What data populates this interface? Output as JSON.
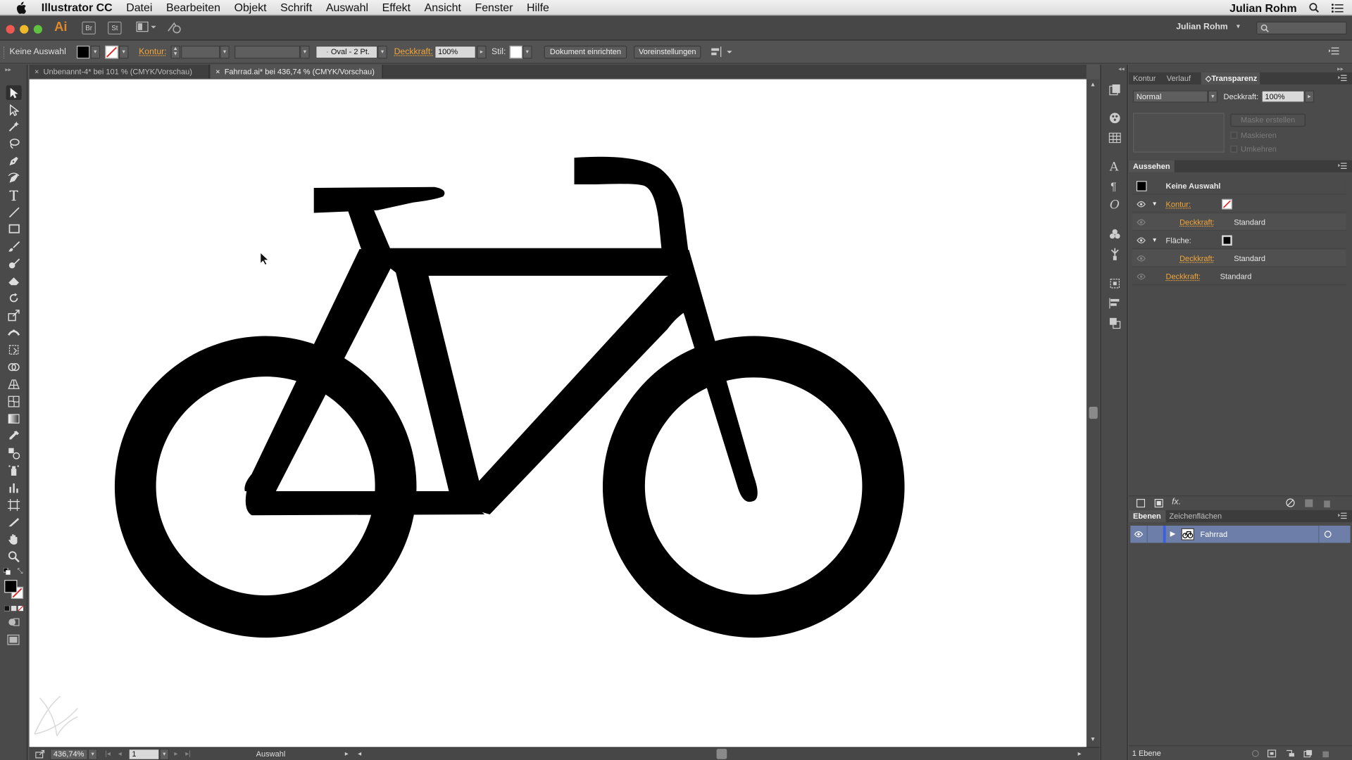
{
  "menubar": {
    "app_name": "Illustrator CC",
    "items": [
      "Datei",
      "Bearbeiten",
      "Objekt",
      "Schrift",
      "Auswahl",
      "Effekt",
      "Ansicht",
      "Fenster",
      "Hilfe"
    ],
    "user": "Julian Rohm"
  },
  "appbar": {
    "logo": "Ai",
    "bridge": "Br",
    "stock": "St",
    "user": "Julian Rohm",
    "search_placeholder": ""
  },
  "controlbar": {
    "selection": "Keine Auswahl",
    "kontur_label": "Kontur:",
    "brush_value": "Oval - 2 Pt.",
    "opacity_label": "Deckkraft:",
    "opacity_value": "100%",
    "style_label": "Stil:",
    "doc_setup_button": "Dokument einrichten",
    "prefs_button": "Voreinstellungen"
  },
  "tabs": [
    {
      "label": "Unbenannt-4* bei 101 % (CMYK/Vorschau)"
    },
    {
      "label": "Fahrrad.ai* bei 436,74 % (CMYK/Vorschau)"
    }
  ],
  "transparency_panel": {
    "tabs": [
      "Kontur",
      "Verlauf",
      "Transparenz"
    ],
    "blend_mode": "Normal",
    "opacity_label": "Deckkraft:",
    "opacity_value": "100%",
    "mask_button": "Maske erstellen",
    "clip_label": "Maskieren",
    "invert_label": "Umkehren"
  },
  "appearance_panel": {
    "title": "Aussehen",
    "header": "Keine Auswahl",
    "rows": [
      {
        "label": "Kontur:",
        "value": ""
      },
      {
        "label": "Deckkraft:",
        "value": "Standard"
      },
      {
        "label": "Fläche:",
        "value": ""
      },
      {
        "label": "Deckkraft:",
        "value": "Standard"
      },
      {
        "label": "Deckkraft:",
        "value": "Standard"
      }
    ],
    "fx": "fx."
  },
  "layers_panel": {
    "tabs": [
      "Ebenen",
      "Zeichenflächen"
    ],
    "layers": [
      {
        "name": "Fahrrad"
      }
    ],
    "count": "1 Ebene"
  },
  "statusbar": {
    "zoom": "436,74%",
    "artboard": "1",
    "tool_status": "Auswahl"
  },
  "colors": {
    "ui_bg": "#535353",
    "accent_orange": "#f2a63a",
    "layer_highlight": "#6d7fa8",
    "artwork": "#000000"
  },
  "icons": [
    "apple-icon",
    "selection-tool-icon",
    "direct-selection-icon",
    "pen-icon",
    "type-icon",
    "rectangle-icon",
    "brush-icon",
    "rotate-icon",
    "zoom-icon",
    "hand-icon",
    "eye-icon",
    "search-icon",
    "menu-icon"
  ]
}
